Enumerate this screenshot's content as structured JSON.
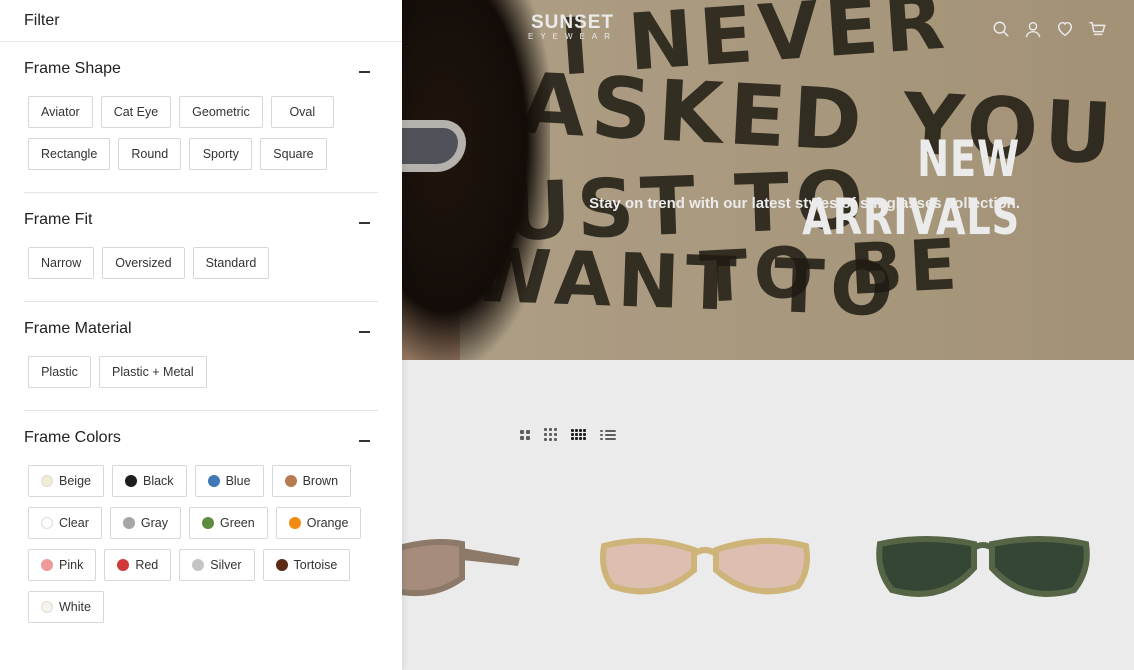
{
  "drawer": {
    "title": "Filter",
    "sections": [
      {
        "title": "Frame Shape",
        "options": [
          "Aviator",
          "Cat Eye",
          "Geometric",
          "Oval",
          "Rectangle",
          "Round",
          "Sporty",
          "Square"
        ]
      },
      {
        "title": "Frame Fit",
        "options": [
          "Narrow",
          "Oversized",
          "Standard"
        ]
      },
      {
        "title": "Frame Material",
        "options": [
          "Plastic",
          "Plastic + Metal"
        ]
      },
      {
        "title": "Frame Colors",
        "colors": [
          {
            "label": "Beige",
            "color": "#f2ecd2"
          },
          {
            "label": "Black",
            "color": "#1e1e1e"
          },
          {
            "label": "Blue",
            "color": "#3f78b4"
          },
          {
            "label": "Brown",
            "color": "#b57c52"
          },
          {
            "label": "Clear",
            "color": "#ffffff"
          },
          {
            "label": "Gray",
            "color": "#a6a6a6"
          },
          {
            "label": "Green",
            "color": "#5e8a3c"
          },
          {
            "label": "Orange",
            "color": "#f28a12"
          },
          {
            "label": "Pink",
            "color": "#ee9a9a"
          },
          {
            "label": "Red",
            "color": "#d13a3a"
          },
          {
            "label": "Silver",
            "color": "#c4c4c4"
          },
          {
            "label": "Tortoise",
            "color": "#5a2a14"
          },
          {
            "label": "White",
            "color": "#f7f3ea"
          }
        ]
      }
    ]
  },
  "store": {
    "brand": "SUNSET",
    "brand_sub": "EYEWEAR",
    "hero_title": "NEW ARRIVALS",
    "hero_subtitle": "Stay on trend with our latest styles of sunglasses collection.",
    "scribbles": [
      "I NEVER",
      "ASKED YOU",
      "TO BE",
      "JUST TO",
      "WANT TO"
    ],
    "header_icons": [
      "search-icon",
      "account-icon",
      "wishlist-icon",
      "cart-icon"
    ],
    "view_icons": [
      "grid-2-icon",
      "grid-3-icon",
      "grid-4-icon",
      "list-icon"
    ]
  },
  "products": [
    {
      "name": "product-1",
      "frame": "#9a8470",
      "lens": "#b59a86"
    },
    {
      "name": "product-2",
      "frame": "#e0c484",
      "lens": "#f0d0c0"
    },
    {
      "name": "product-3",
      "frame": "#5d6e4d",
      "lens": "#3b4d3a"
    }
  ],
  "colors": {
    "chip_border": "#d7d7d7",
    "hero_text": "#ffffff",
    "drawer_bg": "#ffffff"
  }
}
